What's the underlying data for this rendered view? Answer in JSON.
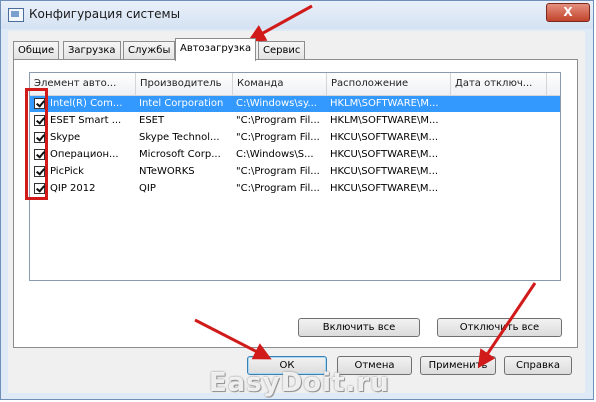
{
  "window": {
    "title": "Конфигурация системы",
    "close_glyph": "X"
  },
  "tabs": [
    {
      "label": "Общие"
    },
    {
      "label": "Загрузка"
    },
    {
      "label": "Службы"
    },
    {
      "label": "Автозагрузка",
      "active": true
    },
    {
      "label": "Сервис"
    }
  ],
  "startup_table": {
    "columns": [
      "Элемент авто...",
      "Производитель",
      "Команда",
      "Расположение",
      "Дата отключ..."
    ],
    "rows": [
      {
        "checked": true,
        "selected": true,
        "item": "Intel(R) Com...",
        "manufacturer": "Intel Corporation",
        "command": "C:\\Windows\\sy...",
        "location": "HKLM\\SOFTWARE\\M...",
        "date": ""
      },
      {
        "checked": true,
        "selected": false,
        "item": "ESET Smart ...",
        "manufacturer": "ESET",
        "command": "\"C:\\Program Fil...",
        "location": "HKLM\\SOFTWARE\\M...",
        "date": ""
      },
      {
        "checked": true,
        "selected": false,
        "item": "Skype",
        "manufacturer": "Skype Technol...",
        "command": "\"C:\\Program Fil...",
        "location": "HKCU\\SOFTWARE\\M...",
        "date": ""
      },
      {
        "checked": true,
        "selected": false,
        "item": "Операцион...",
        "manufacturer": "Microsoft Corp...",
        "command": "C:\\Windows\\S...",
        "location": "HKCU\\SOFTWARE\\M...",
        "date": ""
      },
      {
        "checked": true,
        "selected": false,
        "item": "PicPick",
        "manufacturer": "NTeWORKS",
        "command": "\"C:\\Program Fil...",
        "location": "HKCU\\SOFTWARE\\M...",
        "date": ""
      },
      {
        "checked": true,
        "selected": false,
        "item": "QIP 2012",
        "manufacturer": "QIP",
        "command": "\"C:\\Program Fil...",
        "location": "HKCU\\SOFTWARE\\M...",
        "date": ""
      }
    ]
  },
  "panel_buttons": {
    "enable_all": "Включить все",
    "disable_all": "Отключить все"
  },
  "dialog_buttons": {
    "ok": "ОК",
    "cancel": "Отмена",
    "apply": "Применить",
    "help": "Справка"
  },
  "watermark": "EasyDoit.ru",
  "colors": {
    "selection": "#3399ff",
    "annotation": "#d11b1b",
    "close_button": "#c2432b"
  }
}
